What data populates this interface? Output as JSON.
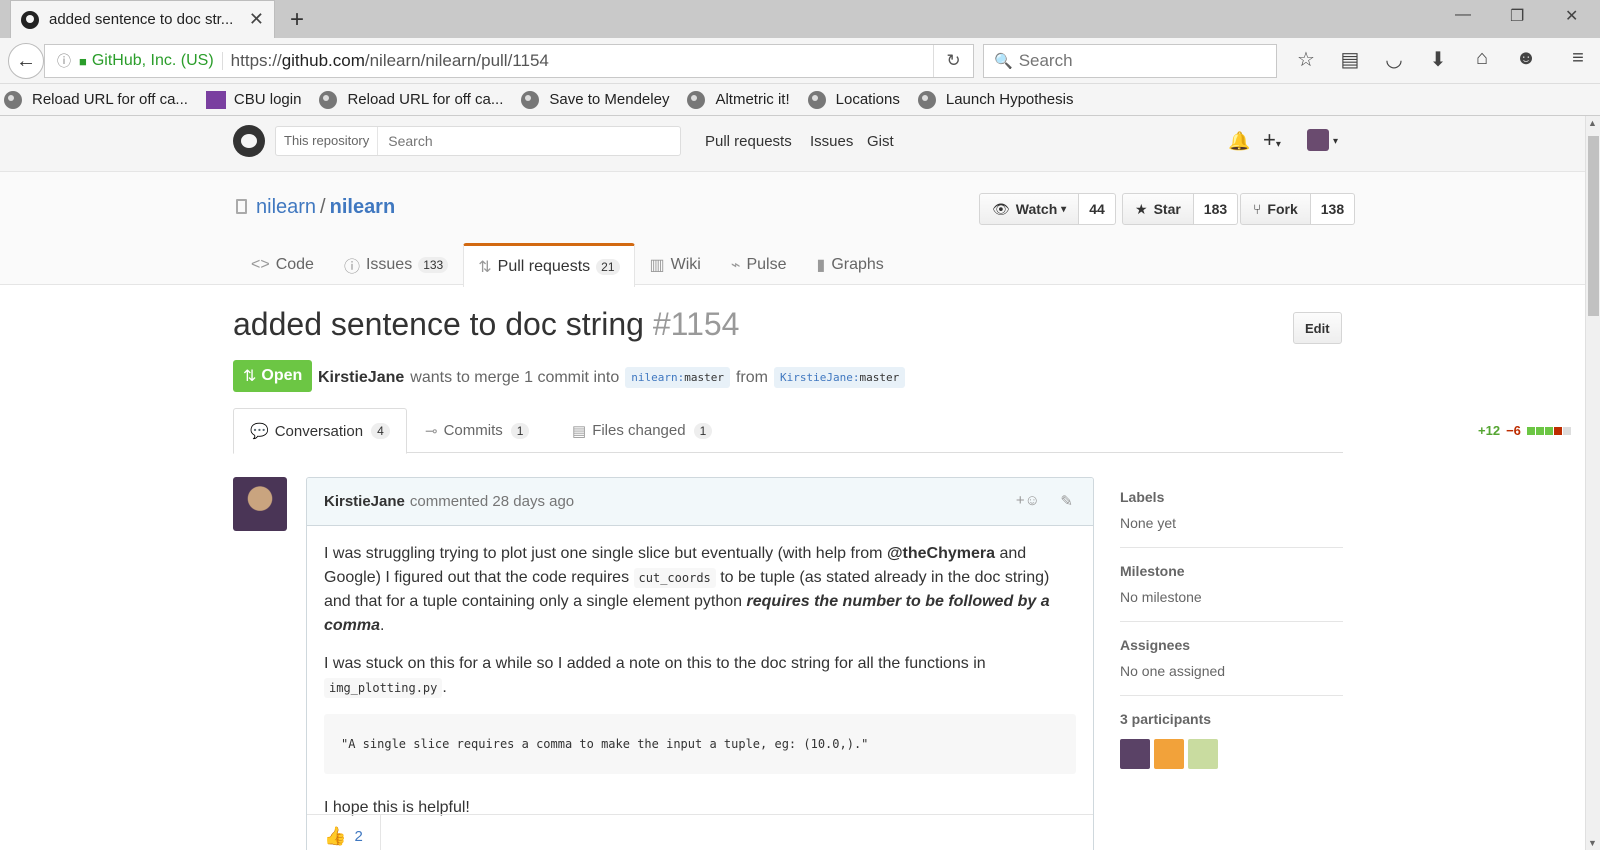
{
  "browser": {
    "tab_title": "added sentence to doc str...",
    "tab_close": "✕",
    "new_tab": "+",
    "org_label": "GitHub, Inc. (US)",
    "url_prefix": "https://",
    "url_host": "github.com",
    "url_path": "/nilearn/nilearn/pull/1154",
    "search_placeholder": "Search",
    "window_controls": [
      "—",
      "❐",
      "✕"
    ],
    "bookmarks": [
      {
        "label": "Reload URL for off ca...",
        "icon": "globe-icon"
      },
      {
        "label": "CBU login",
        "icon": "cbu-icon"
      },
      {
        "label": "Reload URL for off ca...",
        "icon": "globe-icon"
      },
      {
        "label": "Save to Mendeley",
        "icon": "globe-icon"
      },
      {
        "label": "Altmetric it!",
        "icon": "globe-icon"
      },
      {
        "label": "Locations",
        "icon": "globe-icon"
      },
      {
        "label": "Launch Hypothesis",
        "icon": "globe-icon"
      }
    ]
  },
  "github_header": {
    "search_scope": "This repository",
    "search_placeholder": "Search",
    "nav": [
      "Pull requests",
      "Issues",
      "Gist"
    ]
  },
  "repo": {
    "owner": "nilearn",
    "name": "nilearn",
    "watch_label": "Watch",
    "watch_count": "44",
    "star_label": "Star",
    "star_count": "183",
    "fork_label": "Fork",
    "fork_count": "138",
    "tabs": [
      {
        "label": "Code",
        "icon": "code-icon",
        "count": ""
      },
      {
        "label": "Issues",
        "icon": "issue-icon",
        "count": "133"
      },
      {
        "label": "Pull requests",
        "icon": "pull-request-icon",
        "count": "21"
      },
      {
        "label": "Wiki",
        "icon": "book-icon",
        "count": ""
      },
      {
        "label": "Pulse",
        "icon": "pulse-icon",
        "count": ""
      },
      {
        "label": "Graphs",
        "icon": "graph-icon",
        "count": ""
      }
    ]
  },
  "pr": {
    "title": "added sentence to doc string",
    "number": "#1154",
    "edit_label": "Edit",
    "state": "Open",
    "author": "KirstieJane",
    "merge_text": "wants to merge 1 commit into",
    "base_owner": "nilearn",
    "base_branch": "master",
    "from_text": "from",
    "head_owner": "KirstieJane",
    "head_branch": "master",
    "tabs": [
      {
        "label": "Conversation",
        "count": "4"
      },
      {
        "label": "Commits",
        "count": "1"
      },
      {
        "label": "Files changed",
        "count": "1"
      }
    ],
    "additions": "+12",
    "deletions": "−6",
    "colors": {
      "open": "#6cc644",
      "add": "#55a532",
      "del": "#bd2c00",
      "link": "#4078c0"
    }
  },
  "comment": {
    "author": "KirstieJane",
    "meta": "commented 28 days ago",
    "p1_a": "I was struggling trying to plot just one single slice but eventually (with help from",
    "p1_mention": "@theChymera",
    "p1_b": "and Google) I figured out that the code requires",
    "p1_code": "cut_coords",
    "p1_c": "to be tuple (as stated already in the doc string) and that for a tuple containing only a single element python",
    "p1_emph": "requires the number to be followed by a comma",
    "p1_d": ".",
    "p2_a": "I was stuck on this for a while so I added a note on this to the doc string for all the functions in",
    "p2_code": "img_plotting.py",
    "p2_b": ".",
    "code_block": "\"A single slice requires a comma to make the input a tuple, eg: (10.0,).\"",
    "p3": "I hope this is helpful!",
    "thumbs_count": "2"
  },
  "sidebar": {
    "labels_head": "Labels",
    "labels_val": "None yet",
    "milestone_head": "Milestone",
    "milestone_val": "No milestone",
    "assignees_head": "Assignees",
    "assignees_val": "No one assigned",
    "participants_head": "3 participants"
  }
}
